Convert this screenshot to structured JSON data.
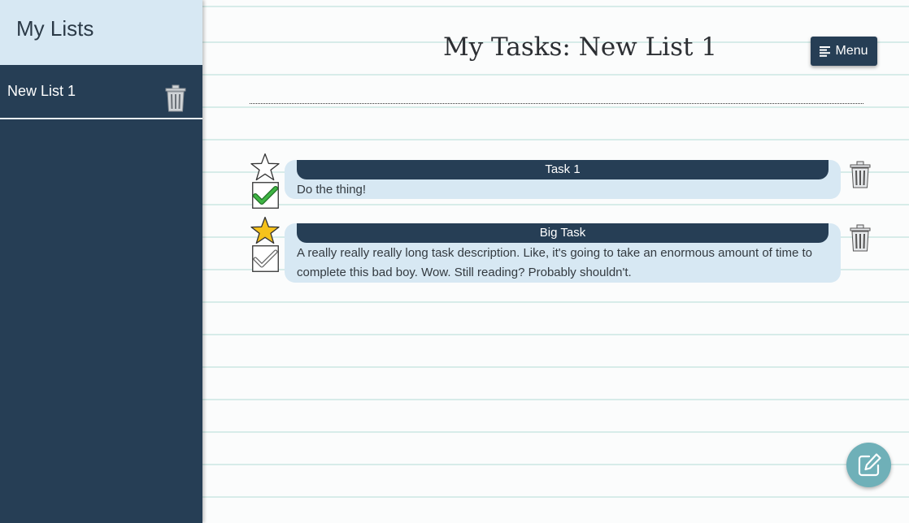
{
  "sidebar": {
    "title": "My Lists",
    "items": [
      {
        "label": "New List 1",
        "icon": "trash-icon"
      }
    ]
  },
  "header": {
    "title": "My Tasks: New List 1",
    "menu_label": "Menu",
    "menu_icon": "hamburger-icon"
  },
  "tasks": [
    {
      "title": "Task 1",
      "description": "Do the thing!",
      "starred": false,
      "completed": true
    },
    {
      "title": "Big Task",
      "description": "A really really really long task description. Like, it's going to take an enormous amount of time to complete this bad boy. Wow. Still reading? Probably shouldn't.",
      "starred": true,
      "completed": false
    }
  ],
  "fab": {
    "icon": "edit-icon"
  },
  "colors": {
    "sidebar_bg": "#263e55",
    "sidebar_header_bg": "#d7e8f3",
    "card_bg": "#d7e8f3",
    "accent": "#263e55",
    "star_filled": "#f6c21b",
    "check_green": "#3aa53d",
    "fab_bg": "#6fb0b8"
  }
}
